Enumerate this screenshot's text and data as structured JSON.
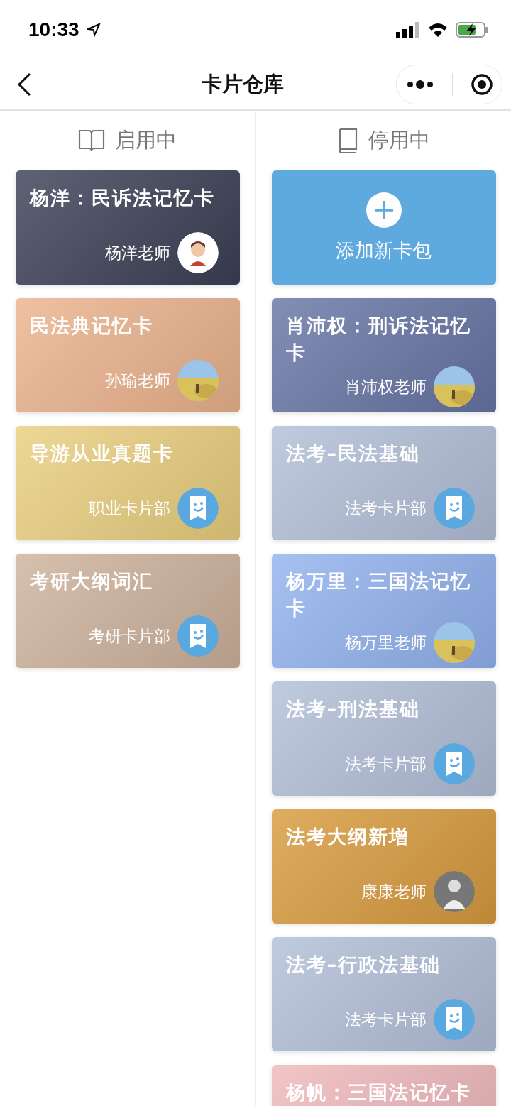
{
  "status_bar": {
    "time": "10:33"
  },
  "nav": {
    "title": "卡片仓库"
  },
  "columns": [
    {
      "header": "启用中",
      "cards": [
        {
          "kind": "cartoon",
          "title": "杨洋：民诉法记忆卡",
          "author": "杨洋老师",
          "color": "#3c4056"
        },
        {
          "title": "民法典记忆卡",
          "author": "孙瑜老师",
          "color": "#ebb38d"
        },
        {
          "kind": "logo",
          "title": "导游从业真题卡",
          "author": "职业卡片部",
          "color": "#eacf7f"
        },
        {
          "kind": "logo",
          "title": "考研大纲词汇",
          "author": "考研卡片部",
          "color": "#cdb29c"
        }
      ]
    },
    {
      "header": "停用中",
      "cards": [
        {
          "kind": "add",
          "title": "添加新卡包",
          "color": "#5eaadf"
        },
        {
          "title": "肖沛权：刑诉法记忆卡",
          "author": "肖沛权老师",
          "color": "#6875a5"
        },
        {
          "kind": "logo",
          "title": "法考–民法基础",
          "author": "法考卡片部",
          "color": "#b3bfd8"
        },
        {
          "title": "杨万里：三国法记忆卡",
          "author": "杨万里老师",
          "color": "#92b2ee"
        },
        {
          "kind": "logo",
          "title": "法考–刑法基础",
          "author": "法考卡片部",
          "color": "#b3bfd8"
        },
        {
          "kind": "person",
          "title": "法考大纲新增",
          "author": "康康老师",
          "color": "#d89b3e"
        },
        {
          "kind": "logo",
          "title": "法考–行政法基础",
          "author": "法考卡片部",
          "color": "#b3bfd8"
        },
        {
          "kind": "plain",
          "title": "杨帆：三国法记忆卡",
          "color": "#efb8bb"
        }
      ]
    }
  ]
}
